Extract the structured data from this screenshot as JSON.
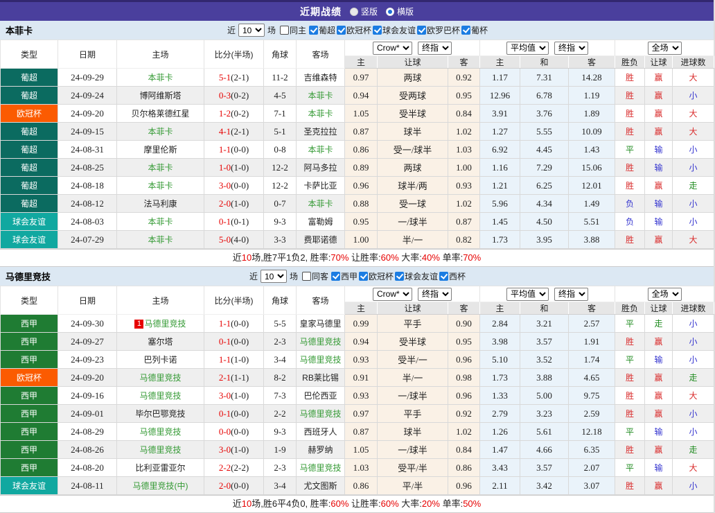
{
  "header": {
    "title": "近期战绩",
    "radios": [
      {
        "label": "竖版",
        "checked": false
      },
      {
        "label": "横版",
        "checked": true
      }
    ]
  },
  "columns": {
    "left": [
      "类型",
      "日期",
      "主场",
      "比分(半场)",
      "角球",
      "客场"
    ],
    "sub": [
      "主",
      "让球",
      "客",
      "主",
      "和",
      "客",
      "胜负",
      "让球",
      "进球数"
    ],
    "widths": [
      83,
      85,
      126,
      86,
      47,
      70,
      47,
      102,
      46,
      58,
      70,
      67,
      43,
      40,
      60
    ]
  },
  "select_groups": [
    [
      "Crow*",
      "终指"
    ],
    [
      "平均值",
      "终指"
    ],
    [
      "全场"
    ]
  ],
  "colors": {
    "type": {
      "葡超": "#0b6b60",
      "欧冠杯": "#fb5b01",
      "球会友谊": "#11a8a0",
      "西甲": "#1f7c33"
    },
    "outcome": {
      "胜": "#d92b2b",
      "平": "#1e8a1e",
      "负": "#3434cf",
      "赢": "#d92b2b",
      "输": "#3434cf",
      "走": "#1e8a1e",
      "大": "#d92b2b",
      "小": "#3434cf"
    },
    "focus_team": "#339933",
    "score": "#e60000"
  },
  "sections": [
    {
      "team": "本菲卡",
      "filter": {
        "prefix": "近",
        "count": "10",
        "suffix": "场",
        "same": {
          "label": "同主",
          "checked": false
        },
        "leagues": [
          {
            "label": "葡超",
            "checked": true
          },
          {
            "label": "欧冠杯",
            "checked": true
          },
          {
            "label": "球会友谊",
            "checked": true
          },
          {
            "label": "欧罗巴杯",
            "checked": true
          },
          {
            "label": "葡杯",
            "checked": true
          }
        ]
      },
      "rows": [
        {
          "type": "葡超",
          "date": "24-09-29",
          "badge": "",
          "home": "本菲卡",
          "hf": true,
          "score": "5-1",
          "half": "(2-1)",
          "corner": "11-2",
          "away": "吉维森特",
          "af": false,
          "odds": [
            "0.97",
            "两球",
            "0.92"
          ],
          "avg": [
            "1.17",
            "7.31",
            "14.28"
          ],
          "res": [
            "胜",
            "赢",
            "大"
          ]
        },
        {
          "type": "葡超",
          "date": "24-09-24",
          "badge": "",
          "home": "博阿维斯塔",
          "hf": false,
          "score": "0-3",
          "half": "(0-2)",
          "corner": "4-5",
          "away": "本菲卡",
          "af": true,
          "odds": [
            "0.94",
            "受两球",
            "0.95"
          ],
          "avg": [
            "12.96",
            "6.78",
            "1.19"
          ],
          "res": [
            "胜",
            "赢",
            "小"
          ]
        },
        {
          "type": "欧冠杯",
          "date": "24-09-20",
          "badge": "",
          "home": "贝尔格莱德红星",
          "hf": false,
          "score": "1-2",
          "half": "(0-2)",
          "corner": "7-1",
          "away": "本菲卡",
          "af": true,
          "odds": [
            "1.05",
            "受半球",
            "0.84"
          ],
          "avg": [
            "3.91",
            "3.76",
            "1.89"
          ],
          "res": [
            "胜",
            "赢",
            "大"
          ]
        },
        {
          "type": "葡超",
          "date": "24-09-15",
          "badge": "",
          "home": "本菲卡",
          "hf": true,
          "score": "4-1",
          "half": "(2-1)",
          "corner": "5-1",
          "away": "圣克拉拉",
          "af": false,
          "odds": [
            "0.87",
            "球半",
            "1.02"
          ],
          "avg": [
            "1.27",
            "5.55",
            "10.09"
          ],
          "res": [
            "胜",
            "赢",
            "大"
          ]
        },
        {
          "type": "葡超",
          "date": "24-08-31",
          "badge": "",
          "home": "摩里伦斯",
          "hf": false,
          "score": "1-1",
          "half": "(0-0)",
          "corner": "0-8",
          "away": "本菲卡",
          "af": true,
          "odds": [
            "0.86",
            "受一/球半",
            "1.03"
          ],
          "avg": [
            "6.92",
            "4.45",
            "1.43"
          ],
          "res": [
            "平",
            "输",
            "小"
          ]
        },
        {
          "type": "葡超",
          "date": "24-08-25",
          "badge": "",
          "home": "本菲卡",
          "hf": true,
          "score": "1-0",
          "half": "(1-0)",
          "corner": "12-2",
          "away": "阿马多拉",
          "af": false,
          "odds": [
            "0.89",
            "两球",
            "1.00"
          ],
          "avg": [
            "1.16",
            "7.29",
            "15.06"
          ],
          "res": [
            "胜",
            "输",
            "小"
          ]
        },
        {
          "type": "葡超",
          "date": "24-08-18",
          "badge": "",
          "home": "本菲卡",
          "hf": true,
          "score": "3-0",
          "half": "(0-0)",
          "corner": "12-2",
          "away": "卡萨比亚",
          "af": false,
          "odds": [
            "0.96",
            "球半/两",
            "0.93"
          ],
          "avg": [
            "1.21",
            "6.25",
            "12.01"
          ],
          "res": [
            "胜",
            "赢",
            "走"
          ]
        },
        {
          "type": "葡超",
          "date": "24-08-12",
          "badge": "",
          "home": "法马利康",
          "hf": false,
          "score": "2-0",
          "half": "(1-0)",
          "corner": "0-7",
          "away": "本菲卡",
          "af": true,
          "odds": [
            "0.88",
            "受一球",
            "1.02"
          ],
          "avg": [
            "5.96",
            "4.34",
            "1.49"
          ],
          "res": [
            "负",
            "输",
            "小"
          ]
        },
        {
          "type": "球会友谊",
          "date": "24-08-03",
          "badge": "",
          "home": "本菲卡",
          "hf": true,
          "score": "0-1",
          "half": "(0-1)",
          "corner": "9-3",
          "away": "富勒姆",
          "af": false,
          "odds": [
            "0.95",
            "一/球半",
            "0.87"
          ],
          "avg": [
            "1.45",
            "4.50",
            "5.51"
          ],
          "res": [
            "负",
            "输",
            "小"
          ]
        },
        {
          "type": "球会友谊",
          "date": "24-07-29",
          "badge": "",
          "home": "本菲卡",
          "hf": true,
          "score": "5-0",
          "half": "(4-0)",
          "corner": "3-3",
          "away": "费耶诺德",
          "af": false,
          "odds": [
            "1.00",
            "半/一",
            "0.82"
          ],
          "avg": [
            "1.73",
            "3.95",
            "3.88"
          ],
          "res": [
            "胜",
            "赢",
            "大"
          ]
        }
      ],
      "summary": [
        {
          "t": "近",
          "red": false
        },
        {
          "t": "10",
          "red": true
        },
        {
          "t": "场,胜7平1负2, 胜率:",
          "red": false
        },
        {
          "t": "70%",
          "red": true
        },
        {
          "t": " 让胜率:",
          "red": false
        },
        {
          "t": "60%",
          "red": true
        },
        {
          "t": " 大率:",
          "red": false
        },
        {
          "t": "40%",
          "red": true
        },
        {
          "t": " 单率:",
          "red": false
        },
        {
          "t": "70%",
          "red": true
        }
      ]
    },
    {
      "team": "马德里竞技",
      "filter": {
        "prefix": "近",
        "count": "10",
        "suffix": "场",
        "same": {
          "label": "同客",
          "checked": false
        },
        "leagues": [
          {
            "label": "西甲",
            "checked": true
          },
          {
            "label": "欧冠杯",
            "checked": true
          },
          {
            "label": "球会友谊",
            "checked": true
          },
          {
            "label": "西杯",
            "checked": true
          }
        ]
      },
      "rows": [
        {
          "type": "西甲",
          "date": "24-09-30",
          "badge": "1",
          "home": "马德里竞技",
          "hf": true,
          "score": "1-1",
          "half": "(0-0)",
          "corner": "5-5",
          "away": "皇家马德里",
          "af": false,
          "odds": [
            "0.99",
            "平手",
            "0.90"
          ],
          "avg": [
            "2.84",
            "3.21",
            "2.57"
          ],
          "res": [
            "平",
            "走",
            "小"
          ]
        },
        {
          "type": "西甲",
          "date": "24-09-27",
          "badge": "",
          "home": "塞尔塔",
          "hf": false,
          "score": "0-1",
          "half": "(0-0)",
          "corner": "2-3",
          "away": "马德里竞技",
          "af": true,
          "odds": [
            "0.94",
            "受半球",
            "0.95"
          ],
          "avg": [
            "3.98",
            "3.57",
            "1.91"
          ],
          "res": [
            "胜",
            "赢",
            "小"
          ]
        },
        {
          "type": "西甲",
          "date": "24-09-23",
          "badge": "",
          "home": "巴列卡诺",
          "hf": false,
          "score": "1-1",
          "half": "(1-0)",
          "corner": "3-4",
          "away": "马德里竞技",
          "af": true,
          "odds": [
            "0.93",
            "受半/一",
            "0.96"
          ],
          "avg": [
            "5.10",
            "3.52",
            "1.74"
          ],
          "res": [
            "平",
            "输",
            "小"
          ]
        },
        {
          "type": "欧冠杯",
          "date": "24-09-20",
          "badge": "",
          "home": "马德里竞技",
          "hf": true,
          "score": "2-1",
          "half": "(1-1)",
          "corner": "8-2",
          "away": "RB莱比锡",
          "af": false,
          "odds": [
            "0.91",
            "半/一",
            "0.98"
          ],
          "avg": [
            "1.73",
            "3.88",
            "4.65"
          ],
          "res": [
            "胜",
            "赢",
            "走"
          ]
        },
        {
          "type": "西甲",
          "date": "24-09-16",
          "badge": "",
          "home": "马德里竞技",
          "hf": true,
          "score": "3-0",
          "half": "(1-0)",
          "corner": "7-3",
          "away": "巴伦西亚",
          "af": false,
          "odds": [
            "0.93",
            "一/球半",
            "0.96"
          ],
          "avg": [
            "1.33",
            "5.00",
            "9.75"
          ],
          "res": [
            "胜",
            "赢",
            "大"
          ]
        },
        {
          "type": "西甲",
          "date": "24-09-01",
          "badge": "",
          "home": "毕尔巴鄂竞技",
          "hf": false,
          "score": "0-1",
          "half": "(0-0)",
          "corner": "2-2",
          "away": "马德里竞技",
          "af": true,
          "odds": [
            "0.97",
            "平手",
            "0.92"
          ],
          "avg": [
            "2.79",
            "3.23",
            "2.59"
          ],
          "res": [
            "胜",
            "赢",
            "小"
          ]
        },
        {
          "type": "西甲",
          "date": "24-08-29",
          "badge": "",
          "home": "马德里竞技",
          "hf": true,
          "score": "0-0",
          "half": "(0-0)",
          "corner": "9-3",
          "away": "西班牙人",
          "af": false,
          "odds": [
            "0.87",
            "球半",
            "1.02"
          ],
          "avg": [
            "1.26",
            "5.61",
            "12.18"
          ],
          "res": [
            "平",
            "输",
            "小"
          ]
        },
        {
          "type": "西甲",
          "date": "24-08-26",
          "badge": "",
          "home": "马德里竞技",
          "hf": true,
          "score": "3-0",
          "half": "(1-0)",
          "corner": "1-9",
          "away": "赫罗纳",
          "af": false,
          "odds": [
            "1.05",
            "一/球半",
            "0.84"
          ],
          "avg": [
            "1.47",
            "4.66",
            "6.35"
          ],
          "res": [
            "胜",
            "赢",
            "走"
          ]
        },
        {
          "type": "西甲",
          "date": "24-08-20",
          "badge": "",
          "home": "比利亚雷亚尔",
          "hf": false,
          "score": "2-2",
          "half": "(2-2)",
          "corner": "2-3",
          "away": "马德里竞技",
          "af": true,
          "odds": [
            "1.03",
            "受平/半",
            "0.86"
          ],
          "avg": [
            "3.43",
            "3.57",
            "2.07"
          ],
          "res": [
            "平",
            "输",
            "大"
          ]
        },
        {
          "type": "球会友谊",
          "date": "24-08-11",
          "badge": "",
          "home": "马德里竞技(中)",
          "hf": true,
          "score": "2-0",
          "half": "(0-0)",
          "corner": "3-4",
          "away": "尤文图斯",
          "af": false,
          "odds": [
            "0.86",
            "平/半",
            "0.96"
          ],
          "avg": [
            "2.11",
            "3.42",
            "3.07"
          ],
          "res": [
            "胜",
            "赢",
            "小"
          ]
        }
      ],
      "summary": [
        {
          "t": "近",
          "red": false
        },
        {
          "t": "10",
          "red": true
        },
        {
          "t": "场,胜6平4负0, 胜率:",
          "red": false
        },
        {
          "t": "60%",
          "red": true
        },
        {
          "t": " 让胜率:",
          "red": false
        },
        {
          "t": "60%",
          "red": true
        },
        {
          "t": " 大率:",
          "red": false
        },
        {
          "t": "20%",
          "red": true
        },
        {
          "t": " 单率:",
          "red": false
        },
        {
          "t": "50%",
          "red": true
        }
      ]
    }
  ]
}
